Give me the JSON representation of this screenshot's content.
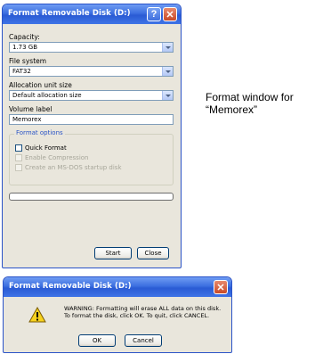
{
  "format_dialog": {
    "title": "Format Removable Disk (D:)",
    "help_button": "?",
    "close_button": "✕",
    "capacity_label": "Capacity:",
    "capacity_value": "1.73 GB",
    "filesystem_label": "File system",
    "filesystem_value": "FAT32",
    "allocation_label": "Allocation unit size",
    "allocation_value": "Default allocation size",
    "volume_label": "Volume label",
    "volume_value": "Memorex",
    "format_options_label": "Format options",
    "quick_format_label": "Quick Format",
    "enable_compression_label": "Enable Compression",
    "msdos_label": "Create an MS-DOS startup disk",
    "progress": 0,
    "start_label": "Start",
    "close_label": "Close"
  },
  "caption": {
    "line1": "Format window for",
    "line2": "“Memorex”"
  },
  "warning_dialog": {
    "title": "Format Removable Disk (D:)",
    "close_button": "✕",
    "message_line1": "WARNING: Formatting will erase ALL data on this disk.",
    "message_line2": "To format the disk, click OK. To quit, click CANCEL.",
    "ok_label": "OK",
    "cancel_label": "Cancel",
    "icon": "warning-icon"
  }
}
